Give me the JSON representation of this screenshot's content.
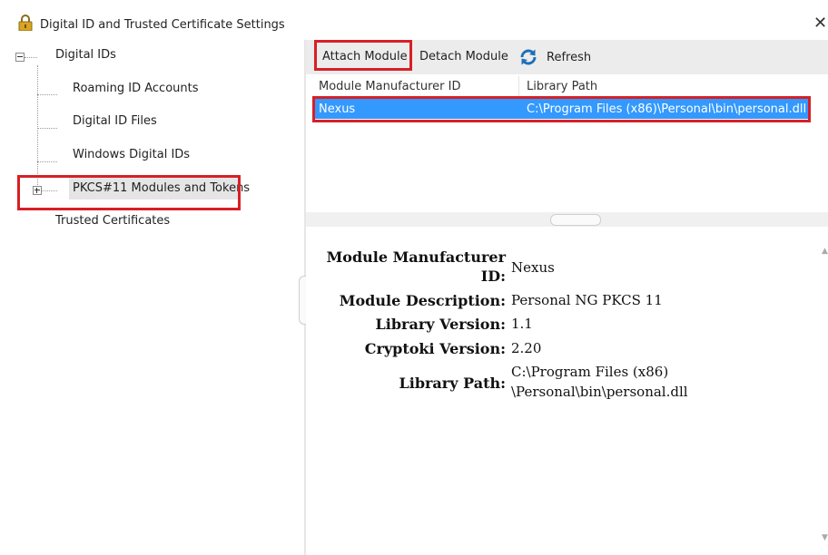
{
  "window": {
    "title": "Digital ID and Trusted Certificate Settings",
    "close_glyph": "✕"
  },
  "tree": {
    "digital_ids": "Digital IDs",
    "roaming": "Roaming ID Accounts",
    "id_files": "Digital ID Files",
    "windows_ids": "Windows Digital IDs",
    "pkcs": "PKCS#11 Modules and Tokens",
    "trusted": "Trusted Certificates"
  },
  "toolbar": {
    "attach": "Attach Module",
    "detach": "Detach Module",
    "refresh": "Refresh"
  },
  "list": {
    "columns": [
      "Module Manufacturer ID",
      "Library Path"
    ],
    "rows": [
      {
        "manufacturer": "Nexus",
        "path": "C:\\Program Files (x86)\\Personal\\bin\\personal.dll"
      }
    ]
  },
  "details": {
    "manufacturer_label_1": "Module Manufacturer",
    "manufacturer_label_2": "ID:",
    "manufacturer_value": "Nexus",
    "description_label": "Module Description:",
    "description_value": "Personal NG PKCS 11",
    "lib_version_label": "Library Version:",
    "lib_version_value": "1.1",
    "cryptoki_label": "Cryptoki Version:",
    "cryptoki_value": "2.20",
    "path_label": "Library Path:",
    "path_value_1": "C:\\Program Files (x86)",
    "path_value_2": "\\Personal\\bin\\personal.dll"
  },
  "colors": {
    "selection": "#3399ff",
    "highlight_box": "#d71f26"
  }
}
